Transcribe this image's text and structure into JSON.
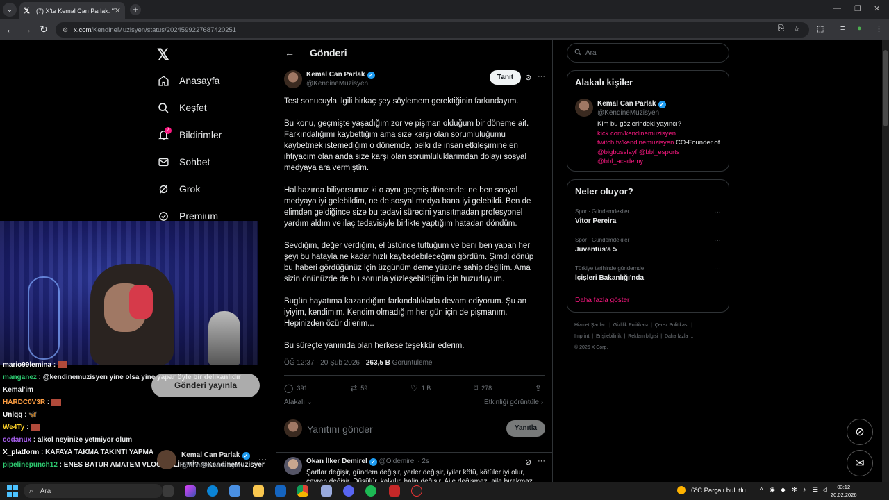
{
  "browser": {
    "tab_title": "(7) X'te Kemal Can Parlak: \"Test",
    "url_prefix": "x.com",
    "url_path": "/KendineMuzisyen/status/2024599227687420251"
  },
  "left_nav": {
    "items": [
      {
        "label": "Anasayfa",
        "icon": "home-icon"
      },
      {
        "label": "Keşfet",
        "icon": "search-icon"
      },
      {
        "label": "Bildirimler",
        "icon": "bell-icon",
        "badge": "7"
      },
      {
        "label": "Sohbet",
        "icon": "mail-icon"
      },
      {
        "label": "Grok",
        "icon": "grok-icon"
      },
      {
        "label": "Premium",
        "icon": "premium-icon"
      }
    ],
    "post_button": "Gönderi yayınla",
    "account": {
      "name": "Kemal Can Parlak",
      "handle": "@KendineMuzisyen"
    }
  },
  "stream_chat": [
    {
      "user": "mario99lemina",
      "color": "#ffffff",
      "text": "",
      "emote": true
    },
    {
      "user": "manganez",
      "color": "#2ecc71",
      "text": "@kendinemuzisyen yine olsa yine yapar öyle bir delikanlıdır",
      "emote": false
    },
    {
      "user": "",
      "color": "#ffffff",
      "text": "Kemal'im",
      "emote": false
    },
    {
      "user": "HARDC0V3R",
      "color": "#ff9f43",
      "text": "",
      "emote": true
    },
    {
      "user": "Unlqq",
      "color": "#ffffff",
      "text": "🦋",
      "emote": false
    },
    {
      "user": "We4Ty",
      "color": "#ffd32a",
      "text": "",
      "emote": true
    },
    {
      "user": "codanux",
      "color": "#a55eea",
      "text": "alkol neyinize yetmiyor olum",
      "emote": false
    },
    {
      "user": "X_platform",
      "color": "#ffffff",
      "text": "KAFAYA TAKMA TAKINTI YAPMA",
      "emote": false
    },
    {
      "user": "pipelinepunch12",
      "color": "#2ecc71",
      "text": "ENES BATUR AMATEM VLOG GELİR Mİ? @KendineMuzisyer",
      "emote": false
    }
  ],
  "main": {
    "header_title": "Gönderi",
    "tweet": {
      "name": "Kemal Can Parlak",
      "handle": "@KendineMuzisyen",
      "follow_label": "Tanıt",
      "paragraphs": [
        "Test sonucuyla ilgili birkaç şey söylemem gerektiğinin farkındayım.",
        "Bu konu, geçmişte yaşadığım zor ve pişman olduğum bir döneme ait. Farkındalığımı kaybettiğim ama size karşı olan sorumluluğumu kaybetmek istemediğim o dönemde, belki de insan etkileşimine en ihtiyacım olan anda size karşı olan sorumluluklarımdan dolayı sosyal medyaya ara vermiştim.",
        "Halihazırda biliyorsunuz ki o aynı geçmiş dönemde; ne ben sosyal medyaya iyi gelebildim, ne de sosyal medya bana iyi gelebildi. Ben de elimden geldiğince size bu tedavi sürecini yansıtmadan profesyonel yardım aldım ve ilaç tedavisiyle birlikte yaptığım hatadan döndüm.",
        "Sevdiğim, değer verdiğim, el üstünde tuttuğum ve beni ben yapan her şeyi bu hatayla ne kadar hızlı kaybedebileceğimi gördüm. Şimdi dönüp bu haberi gördüğünüz için üzgünüm deme yüzüne sahip değilim. Ama sizin önünüzde de bu sorunla yüzleşebildiğim için huzurluyum.",
        "Bugün hayatıma kazandığım farkındalıklarla devam ediyorum. Şu an iyiyim, kendimim. Kendim olmadığım her gün için de pişmanım. Hepinizden özür dilerim...",
        "Bu süreçte yanımda olan herkese teşekkür ederim."
      ],
      "time": "ÖĞ 12:37 · 20 Şub 2026 · ",
      "views_count": "263,5 B",
      "views_label": "Görüntüleme",
      "replies": "391",
      "retweets": "59",
      "likes": "1 B",
      "bookmarks": "278",
      "relevance_label": "Alakalı",
      "activity_label": "Etkinliği görüntüle"
    },
    "reply_placeholder": "Yanıtını gönder",
    "reply_button": "Yanıtla",
    "reply": {
      "name": "Okan İlker Demirel",
      "handle": "@Oldemirel · 2s",
      "text": "Şartlar değişir, gündem değişir, yerler değişir, iyiler kötü, kötüler iyi olur, çevren değişir. Düşülür, kalkılır, halin değişir. Aile değişmez, aile bırakmaz."
    }
  },
  "sidebar": {
    "search_placeholder": "Ara",
    "relevant_title": "Alakalı kişiler",
    "relevant_person": {
      "name": "Kemal Can Parlak",
      "handle": "@KendineMuzisyen",
      "bio_line1": "Kim bu gözlerindeki yayıncı?",
      "link1": "kick.com/kendinemuzisyen",
      "link2": "twitch.tv/kendinemuzisyen",
      "bio_tail": " CO-Founder of ",
      "mention1": "@bigbosslayf",
      "mention2": "@bbl_esports",
      "mention3": "@bbl_academy"
    },
    "trends_title": "Neler oluyor?",
    "trends": [
      {
        "category": "Spor · Gündemdekiler",
        "title": "Vitor Pereira"
      },
      {
        "category": "Spor · Gündemdekiler",
        "title": "Juventus'a 5"
      },
      {
        "category": "Türkiye tarihinde gündemde",
        "title": "İçişleri Bakanlığı'nda"
      }
    ],
    "show_more": "Daha fazla göster",
    "footer_links": [
      "Hizmet Şartları",
      "|",
      "Gizlilik Politikası",
      "|",
      "Çerez Politikası",
      "|",
      "Imprint",
      "|",
      "Erişilebilirlik",
      "|",
      "Reklam bilgisi",
      "|",
      "Daha fazla ..."
    ],
    "copyright": "© 2026 X Corp."
  },
  "taskbar": {
    "search_placeholder": "Ara",
    "weather": "6°C  Parçalı bulutlu",
    "time": "03:12",
    "date": "20.02.2026"
  },
  "colors": {
    "accent_pink": "#f91880",
    "verified_blue": "#1d9bf0"
  }
}
